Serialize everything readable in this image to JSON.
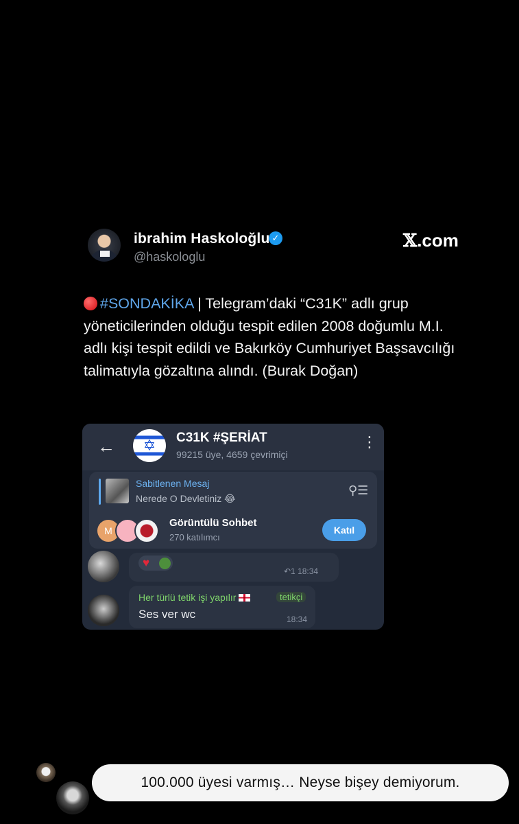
{
  "tweet": {
    "author_name": "ibrahim Haskoloğlu",
    "verified_mark": "✓",
    "handle": "@haskologlu",
    "site": {
      "x": "𝕏",
      "rest": ".com"
    },
    "hashtag": "#SONDAKİKA",
    "text_rest": " | Telegram’daki “C31K” adlı grup yöneticilerinden olduğu tespit edilen 2008 doğumlu M.I. adlı kişi tespit edildi ve Bakırköy Cumhuriyet Başsavcılığı talimatıyla gözaltına alındı. (Burak Doğan)"
  },
  "telegram": {
    "back_icon": "←",
    "group_title": "C31K #ŞERİAT",
    "group_subtitle": "99215 üye, 4659 çevrimiçi",
    "menu_icon": "⋮",
    "star_glyph": "✡",
    "pinned": {
      "title": "Sabitlenen Mesaj",
      "text": "Nerede O Devletiniz 😂",
      "icon": "⚲☰"
    },
    "video_chat": {
      "avatar_letter": "M",
      "title": "Görüntülü Sohbet",
      "participants": "270 katılımcı",
      "join_label": "Katıl"
    },
    "message1": {
      "reaction": "♥",
      "meta": "↶1 18:34"
    },
    "message2": {
      "sender": "Her türlü tetik işi yapılır",
      "tag": "tetikçi",
      "text": "Ses ver wc",
      "time": "18:34"
    }
  },
  "reply": {
    "text": "100.000 üyesi varmış… Neyse bişey demiyorum."
  }
}
